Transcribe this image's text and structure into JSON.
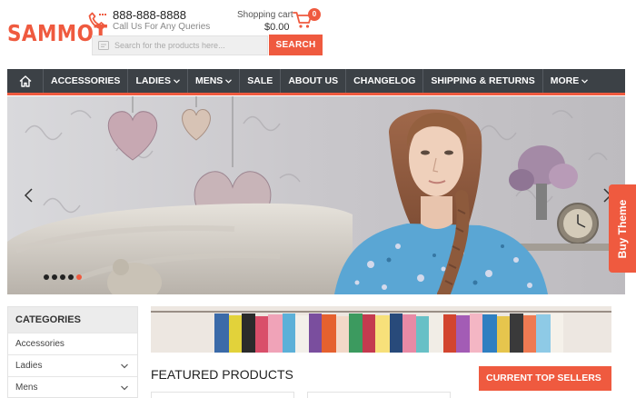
{
  "brand": {
    "logo": "SAMMOT",
    "accent": "#ef5a3f",
    "nav_bg": "#3c4146"
  },
  "contact": {
    "phone": "888-888-8888",
    "subtitle": "Call Us For Any Queries",
    "icon": "phone-icon"
  },
  "cart": {
    "label": "Shopping cart",
    "total": "$0.00",
    "count": "0",
    "icon": "cart-icon"
  },
  "search": {
    "placeholder": "Search for the products here...",
    "button": "SEARCH"
  },
  "nav": {
    "home_icon": "home-icon",
    "items": [
      {
        "label": "ACCESSORIES",
        "dropdown": false
      },
      {
        "label": "LADIES",
        "dropdown": true
      },
      {
        "label": "MENS",
        "dropdown": true
      },
      {
        "label": "SALE",
        "dropdown": false
      },
      {
        "label": "ABOUT US",
        "dropdown": false
      },
      {
        "label": "CHANGELOG",
        "dropdown": false
      },
      {
        "label": "SHIPPING & RETURNS",
        "dropdown": false
      },
      {
        "label": "MORE",
        "dropdown": true
      }
    ]
  },
  "slider": {
    "dots": 5,
    "active_dot": 5,
    "prev_icon": "chevron-left-icon",
    "next_icon": "chevron-right-icon"
  },
  "buy_theme": "Buy Theme",
  "categories": {
    "title": "CATEGORIES",
    "items": [
      {
        "label": "Accessories",
        "expandable": false
      },
      {
        "label": "Ladies",
        "expandable": true
      },
      {
        "label": "Mens",
        "expandable": true
      }
    ]
  },
  "featured": {
    "title": "FEATURED PRODUCTS"
  },
  "top_sellers": {
    "title": "CURRENT TOP SELLERS"
  }
}
